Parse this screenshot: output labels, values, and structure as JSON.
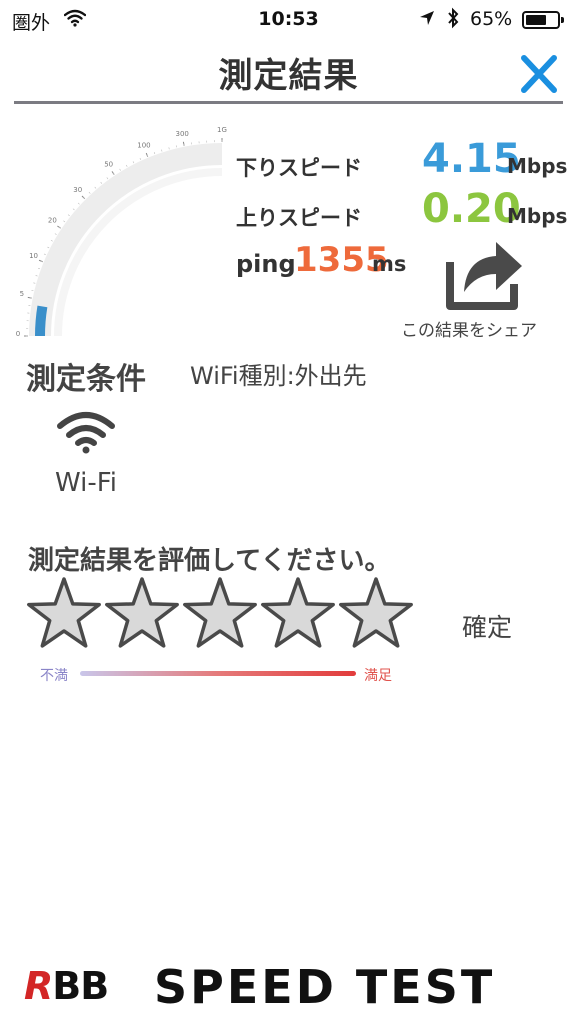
{
  "status_bar": {
    "carrier": "圏外",
    "time": "10:53",
    "battery_percent": "65%",
    "battery_level": 0.65,
    "icons": [
      "wifi-icon",
      "location-arrow-icon",
      "bluetooth-icon",
      "battery-icon"
    ]
  },
  "header": {
    "title": "測定結果",
    "close_icon": "close-icon",
    "close_color": "#1a8fe0"
  },
  "gauge": {
    "ticks": [
      "0",
      "5",
      "10",
      "20",
      "30",
      "50",
      "100",
      "300",
      "1G"
    ],
    "value": 4.15,
    "fill_color": "#3a8fca",
    "track_color": "#ededed"
  },
  "results": {
    "download_label": "下りスピード",
    "download_value": "4.15",
    "download_unit": "Mbps",
    "download_color": "#3a9bd9",
    "upload_label": "上りスピード",
    "upload_value": "0.20",
    "upload_unit": "Mbps",
    "upload_color": "#8cc63f",
    "ping_label": "ping",
    "ping_value": "1355",
    "ping_unit": "ms",
    "ping_color": "#ee6a3b"
  },
  "share": {
    "label": "この結果をシェア",
    "icon": "share-icon"
  },
  "conditions": {
    "title": "測定条件",
    "wifi_type": "WiFi種別:外出先",
    "network_label": "Wi-Fi",
    "network_icon": "wifi-icon"
  },
  "rating": {
    "title": "測定結果を評価してください。",
    "star_count": 5,
    "selected": 0,
    "confirm_label": "確定",
    "scale_low": "不満",
    "scale_high": "満足"
  },
  "footer": {
    "logo_r": "R",
    "logo_bb": "BB",
    "logo_text": "SPEED TEST"
  }
}
